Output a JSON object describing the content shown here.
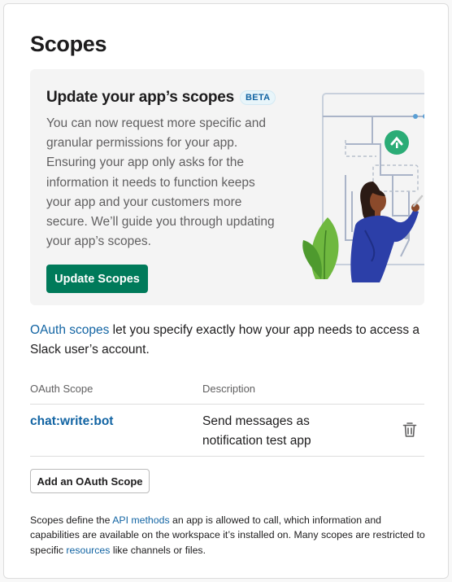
{
  "page": {
    "title": "Scopes"
  },
  "promo": {
    "title": "Update your app’s scopes",
    "badge": "BETA",
    "description": "You can now request more specific and granular permissions for your app. Ensuring your app only asks for the information it needs to function keeps your app and your customers more secure. We’ll guide you through updating your app’s scopes.",
    "button_label": "Update Scopes",
    "illustration": "person-drawing-flowchart-with-plant"
  },
  "oauth_intro": {
    "link_text": "OAuth scopes",
    "rest_text": " let you specify exactly how your app needs to access a Slack user’s account."
  },
  "table": {
    "headers": {
      "scope": "OAuth Scope",
      "description": "Description"
    },
    "rows": [
      {
        "scope": "chat:write:bot",
        "description": "Send messages as notification test app",
        "action_icon": "trash-icon"
      }
    ]
  },
  "add_button_label": "Add an OAuth Scope",
  "footnote": {
    "part1": "Scopes define the ",
    "link1": "API methods",
    "part2": " an app is allowed to call, which information and capabilities are available on the workspace it’s installed on. Many scopes are restricted to specific ",
    "link2": "resources",
    "part3": " like channels or files."
  },
  "colors": {
    "accent_green": "#007a5a",
    "link_blue": "#1264a3",
    "promo_bg": "#f4f4f4",
    "plant_green": "#6fb83f",
    "figure_blue": "#2c3fa8",
    "teal": "#2bac76",
    "yellow": "#ecb22e"
  }
}
